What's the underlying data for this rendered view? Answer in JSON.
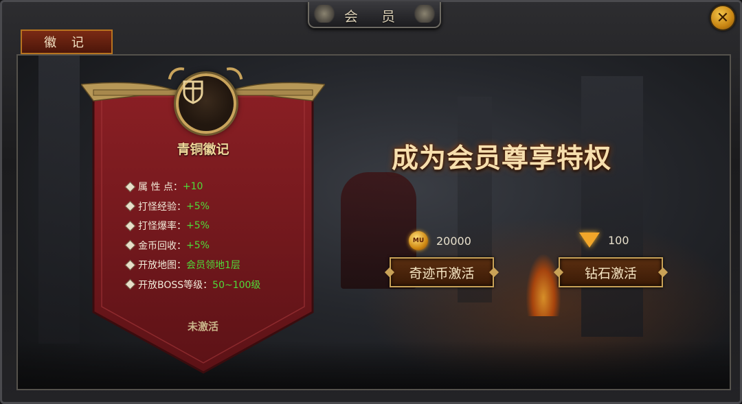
{
  "window": {
    "title": "会 员",
    "close_icon": "✕"
  },
  "tabs": [
    {
      "label": "徽 记",
      "active": true
    }
  ],
  "badge": {
    "name": "青铜徽记",
    "emblem_icon": "shield-emblem-icon",
    "stats": [
      {
        "label": "属 性 点：",
        "value": "+10"
      },
      {
        "label": "打怪经验：",
        "value": "+5%"
      },
      {
        "label": "打怪爆率：",
        "value": "+5%"
      },
      {
        "label": "金币回收：",
        "value": "+5%"
      },
      {
        "label": "开放地图：",
        "value": "会员领地1层"
      },
      {
        "label": "开放BOSS等级：",
        "value": "50~100级"
      }
    ],
    "status": "未激活"
  },
  "promo": {
    "headline": "成为会员尊享特权",
    "coin_option": {
      "icon": "miracle-coin-icon",
      "icon_text": "MU",
      "price": "20000",
      "button": "奇迹币激活"
    },
    "diamond_option": {
      "icon": "diamond-icon",
      "price": "100",
      "button": "钻石激活"
    }
  },
  "colors": {
    "stat_value": "#4fdc3a",
    "headline": "#f6dfae",
    "banner": "#7a1a1e",
    "gold_trim": "#c9a45c"
  }
}
